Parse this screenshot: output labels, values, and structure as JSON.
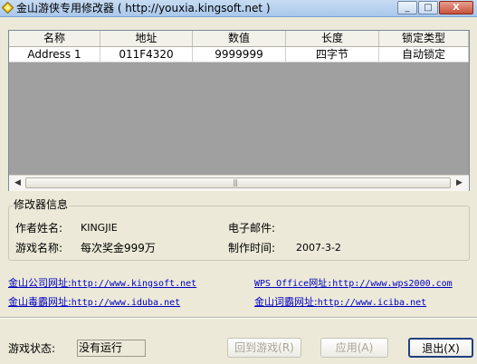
{
  "window": {
    "title": "金山游侠专用修改器 ( http://youxia.kingsoft.net )",
    "controls": {
      "minimize": "_",
      "maximize": "□",
      "close": "X"
    }
  },
  "table": {
    "columns": [
      "名称",
      "地址",
      "数值",
      "长度",
      "锁定类型"
    ],
    "rows": [
      [
        "Address 1",
        "011F4320",
        "9999999",
        "四字节",
        "自动锁定"
      ]
    ]
  },
  "info": {
    "group_label": "修改器信息",
    "author_label": "作者姓名:",
    "author_value": "KINGJIE",
    "email_label": "电子邮件:",
    "game_label": "游戏名称:",
    "game_value": "每次奖金999万",
    "date_label": "制作时间:",
    "date_value": "2007-3-2"
  },
  "links": {
    "kingsoft_label": "金山公司网址:",
    "kingsoft_url": "http://www.kingsoft.net",
    "wps_label": "WPS Office网址:",
    "wps_url": "http://www.wps2000.com",
    "iduba_label": "金山毒霸网址:",
    "iduba_url": "http://www.iduba.net",
    "iciba_label": "金山词霸网址:",
    "iciba_url": "http://www.iciba.net"
  },
  "status": {
    "label": "游戏状态:",
    "value": "没有运行"
  },
  "buttons": {
    "back_to_game": "回到游戏(R)",
    "apply": "应用(A)",
    "exit": "退出(X)"
  }
}
